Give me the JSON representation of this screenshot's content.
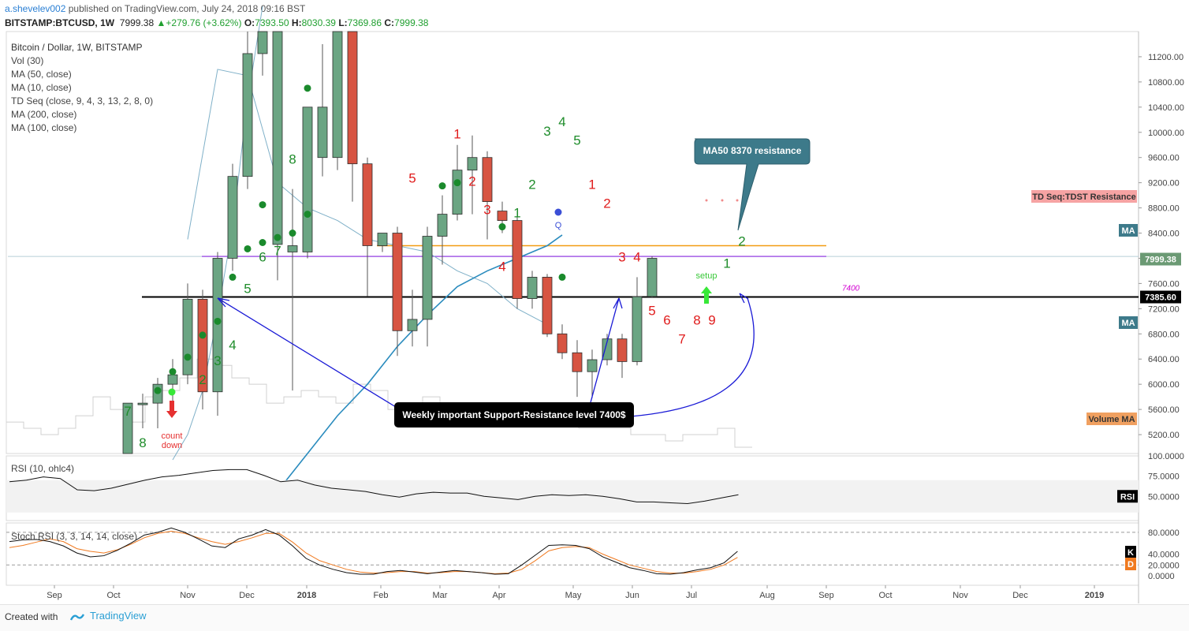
{
  "header": {
    "user": "a.shevelev002",
    "published": "published on TradingView.com, July 24, 2018 09:16 BST",
    "symbol": "BITSTAMP:BTCUSD, 1W",
    "last": "7999.38",
    "change": "+279.76 (+3.62%)",
    "o_label": "O:",
    "o": "7393.50",
    "h_label": "H:",
    "h": "8030.39",
    "l_label": "L:",
    "l": "7369.86",
    "c_label": "C:",
    "c": "7999.38"
  },
  "legend": {
    "title": "Bitcoin / Dollar, 1W, BITSTAMP",
    "items": [
      "Vol (30)",
      "MA (50, close)",
      "MA (10, close)",
      "TD Seq (close, 9, 4, 3, 13, 2, 8, 0)",
      "MA (200, close)",
      "MA (100, close)"
    ]
  },
  "panes": {
    "rsi_label": "RSI (10, ohlc4)",
    "stoch_label": "Stoch RSI (3, 3, 14, 14, close)"
  },
  "footer": {
    "created": "Created with",
    "brand": "TradingView"
  },
  "colors": {
    "up": "#6ba583",
    "down": "#d75442",
    "td_green": "#1e8c2a",
    "td_red": "#e01c1c",
    "ma_blue": "#2b8cbe",
    "ma_thin": "#7fb0c8",
    "orange": "#f39c12",
    "purple": "#8b2be2",
    "callout": "#3d7a8a"
  },
  "chart_data": [
    {
      "type": "candlestick",
      "title": "Bitcoin / Dollar, 1W, BITSTAMP",
      "ylim": [
        4900,
        11600
      ],
      "yticks": [
        5200,
        5600,
        6000,
        6400,
        6800,
        7200,
        7600,
        8000,
        8400,
        8800,
        9200,
        9600,
        10000,
        10400,
        10800,
        11200
      ],
      "ytick_labels": [
        "5200.00",
        "5600.00",
        "6000.00",
        "6400.00",
        "6800.00",
        "7200.00",
        "7600.00",
        "8000.00",
        "8400.00",
        "8800.00",
        "9200.00",
        "9600.00",
        "10000.00",
        "10400.00",
        "10800.00",
        "11200.00"
      ],
      "xlabels": [
        "Sep",
        "Oct",
        "Nov",
        "Dec",
        "2018",
        "Feb",
        "Mar",
        "Apr",
        "May",
        "Jun",
        "Jul",
        "Aug",
        "Sep",
        "Oct",
        "Nov",
        "Dec",
        "2019"
      ],
      "candles": [
        {
          "o": 4600,
          "h": 5500,
          "l": 4200,
          "c": 5700
        },
        {
          "o": 5700,
          "h": 5850,
          "l": 5300,
          "c": 5700
        },
        {
          "o": 5700,
          "h": 6100,
          "l": 5300,
          "c": 6000
        },
        {
          "o": 6000,
          "h": 6400,
          "l": 5500,
          "c": 6150
        },
        {
          "o": 6150,
          "h": 7600,
          "l": 6000,
          "c": 7350
        },
        {
          "o": 7350,
          "h": 7500,
          "l": 5600,
          "c": 5880
        },
        {
          "o": 5880,
          "h": 8100,
          "l": 5500,
          "c": 8000
        },
        {
          "o": 8000,
          "h": 9500,
          "l": 7800,
          "c": 9300
        },
        {
          "o": 9300,
          "h": 11700,
          "l": 9100,
          "c": 11250
        },
        {
          "o": 11250,
          "h": 11800,
          "l": 10900,
          "c": 11700
        },
        {
          "o": 8220,
          "h": 11900,
          "l": 7650,
          "c": 11700
        },
        {
          "o": 8100,
          "h": 9100,
          "l": 5900,
          "c": 8200
        },
        {
          "o": 8100,
          "h": 10400,
          "l": 8000,
          "c": 10400
        },
        {
          "o": 9600,
          "h": 11400,
          "l": 9300,
          "c": 10400
        },
        {
          "o": 9600,
          "h": 11800,
          "l": 9400,
          "c": 11600
        },
        {
          "o": 11600,
          "h": 11700,
          "l": 8900,
          "c": 9500
        },
        {
          "o": 9500,
          "h": 9600,
          "l": 7400,
          "c": 8200
        },
        {
          "o": 8200,
          "h": 8400,
          "l": 8100,
          "c": 8400
        },
        {
          "o": 8400,
          "h": 8500,
          "l": 6450,
          "c": 6850
        },
        {
          "o": 6850,
          "h": 7500,
          "l": 6600,
          "c": 7030
        },
        {
          "o": 7030,
          "h": 8500,
          "l": 6600,
          "c": 8350
        },
        {
          "o": 8350,
          "h": 9000,
          "l": 7900,
          "c": 8700
        },
        {
          "o": 8700,
          "h": 9800,
          "l": 8600,
          "c": 9400
        },
        {
          "o": 9400,
          "h": 9950,
          "l": 8700,
          "c": 9600
        },
        {
          "o": 9600,
          "h": 9700,
          "l": 8300,
          "c": 8900
        },
        {
          "o": 8750,
          "h": 8900,
          "l": 8400,
          "c": 8600
        },
        {
          "o": 8600,
          "h": 8650,
          "l": 7200,
          "c": 7360
        },
        {
          "o": 7360,
          "h": 7800,
          "l": 7200,
          "c": 7700
        },
        {
          "o": 7700,
          "h": 7750,
          "l": 6750,
          "c": 6800
        },
        {
          "o": 6800,
          "h": 6950,
          "l": 6400,
          "c": 6500
        },
        {
          "o": 6500,
          "h": 6700,
          "l": 5800,
          "c": 6200
        },
        {
          "o": 6200,
          "h": 6550,
          "l": 5780,
          "c": 6390
        },
        {
          "o": 6390,
          "h": 6800,
          "l": 6300,
          "c": 6720
        },
        {
          "o": 6720,
          "h": 6800,
          "l": 6100,
          "c": 6360
        },
        {
          "o": 6360,
          "h": 7700,
          "l": 6300,
          "c": 7390
        },
        {
          "o": 7393.5,
          "h": 8030.39,
          "l": 7369.86,
          "c": 7999.38
        }
      ],
      "ma50": [
        [
          17,
          4300
        ],
        [
          19,
          4900
        ],
        [
          21,
          5500
        ],
        [
          23,
          6000
        ],
        [
          25,
          6600
        ],
        [
          27,
          7100
        ],
        [
          29,
          7550
        ],
        [
          31,
          7800
        ],
        [
          33,
          8000
        ],
        [
          35,
          8200
        ],
        [
          36,
          8370
        ]
      ],
      "ma10": [
        [
          11,
          8300
        ],
        [
          13,
          11000
        ],
        [
          15,
          10900
        ],
        [
          17,
          9200
        ],
        [
          19,
          8800
        ],
        [
          21,
          8600
        ],
        [
          23,
          8300
        ],
        [
          25,
          8200
        ],
        [
          27,
          8100
        ],
        [
          29,
          7800
        ],
        [
          31,
          7600
        ],
        [
          33,
          7200
        ],
        [
          35,
          6950
        ]
      ],
      "ma_rise": [
        [
          10,
          4800
        ],
        [
          11,
          5200
        ],
        [
          12,
          5900
        ],
        [
          13,
          7100
        ],
        [
          14,
          8500
        ],
        [
          15,
          10500
        ],
        [
          16,
          12000
        ]
      ],
      "td_labels": [
        {
          "i": 0,
          "t": "7",
          "c": "g",
          "y": 5500
        },
        {
          "i": 1,
          "t": "8",
          "c": "g",
          "y": 5000
        },
        {
          "i": 5,
          "t": "2",
          "c": "g",
          "y": 6000
        },
        {
          "i": 6,
          "t": "3",
          "c": "g",
          "y": 6300
        },
        {
          "i": 7,
          "t": "4",
          "c": "g",
          "y": 6550
        },
        {
          "i": 8,
          "t": "5",
          "c": "g",
          "y": 7450
        },
        {
          "i": 9,
          "t": "6",
          "c": "g",
          "y": 7950
        },
        {
          "i": 10,
          "t": "7",
          "c": "g",
          "y": 8050
        },
        {
          "i": 11,
          "t": "8",
          "c": "g",
          "y": 9500
        },
        {
          "i": 19,
          "t": "5",
          "c": "r",
          "y": 9200
        },
        {
          "i": 22,
          "t": "1",
          "c": "r",
          "y": 9900
        },
        {
          "i": 23,
          "t": "2",
          "c": "r",
          "y": 9150
        },
        {
          "i": 24,
          "t": "3",
          "c": "r",
          "y": 8700
        },
        {
          "i": 25,
          "t": "4",
          "c": "r",
          "y": 7800
        },
        {
          "i": 26,
          "t": "1",
          "c": "g",
          "y": 8650
        },
        {
          "i": 27,
          "t": "2",
          "c": "g",
          "y": 9100
        },
        {
          "i": 28,
          "t": "3",
          "c": "g",
          "y": 9950
        },
        {
          "i": 29,
          "t": "4",
          "c": "g",
          "y": 10100
        },
        {
          "i": 30,
          "t": "5",
          "c": "g",
          "y": 9800
        },
        {
          "i": 31,
          "t": "1",
          "c": "r",
          "y": 9100
        },
        {
          "i": 32,
          "t": "2",
          "c": "r",
          "y": 8800
        },
        {
          "i": 33,
          "t": "3",
          "c": "r",
          "y": 7950
        },
        {
          "i": 34,
          "t": "4",
          "c": "r",
          "y": 7950
        },
        {
          "i": 35,
          "t": "5",
          "c": "r",
          "y": 7100
        },
        {
          "i": 36,
          "t": "6",
          "c": "r",
          "y": 6950
        },
        {
          "i": 37,
          "t": "7",
          "c": "r",
          "y": 6650
        },
        {
          "i": 38,
          "t": "8",
          "c": "r",
          "y": 6950
        },
        {
          "i": 39,
          "t": "9",
          "c": "r",
          "y": 6950
        },
        {
          "i": 40,
          "t": "1",
          "c": "g",
          "y": 7850
        },
        {
          "i": 41,
          "t": "2",
          "c": "g",
          "y": 8200
        }
      ],
      "annotations": {
        "support_value": 7385.6,
        "support_label": "7385.60",
        "support_note": "7400",
        "support_text": "Weekly important Support-Resistance level 7400$",
        "ma50_callout": "MA50 8370 resistance",
        "tdst_label": "TD Seq:TDST Resistance",
        "last_price": "7999.38",
        "ma_tag": "MA",
        "volume_ma_tag": "Volume MA",
        "setup": "setup",
        "countdown": "count\ndown",
        "q_marker": "Q"
      }
    },
    {
      "type": "line",
      "title": "RSI (10, ohlc4)",
      "ylim": [
        20,
        100
      ],
      "yticks": [
        50,
        75,
        100
      ],
      "ytick_labels": [
        "50.0000",
        "75.0000",
        "100.0000"
      ],
      "values": [
        68,
        70,
        74,
        72,
        58,
        57,
        60,
        65,
        70,
        74,
        76,
        79,
        82,
        83,
        83,
        76,
        68,
        70,
        64,
        60,
        58,
        56,
        52,
        49,
        53,
        55,
        54,
        54,
        50,
        48,
        46,
        50,
        52,
        51,
        52,
        50,
        47,
        43,
        43,
        42,
        41,
        44,
        48,
        52
      ],
      "last_label": "RSI"
    },
    {
      "type": "line",
      "title": "Stoch RSI (3, 3, 14, 14, close)",
      "ylim": [
        -10,
        90
      ],
      "yticks": [
        0,
        20,
        40,
        80
      ],
      "ytick_labels": [
        "0.0000",
        "20.0000",
        "40.0000",
        "80.0000"
      ],
      "series": [
        {
          "name": "K",
          "values": [
            63,
            66,
            67,
            63,
            55,
            42,
            35,
            37,
            47,
            60,
            75,
            80,
            88,
            80,
            68,
            55,
            52,
            68,
            75,
            85,
            75,
            55,
            32,
            20,
            12,
            6,
            3,
            3,
            8,
            10,
            7,
            4,
            7,
            10,
            8,
            6,
            3,
            4,
            20,
            38,
            56,
            57,
            56,
            50,
            35,
            25,
            15,
            10,
            4,
            3,
            6,
            11,
            15,
            24,
            45
          ]
        },
        {
          "name": "D",
          "values": [
            52,
            56,
            62,
            68,
            63,
            50,
            45,
            42,
            48,
            58,
            70,
            78,
            82,
            78,
            70,
            63,
            58,
            63,
            70,
            78,
            78,
            62,
            42,
            28,
            20,
            12,
            7,
            5,
            6,
            8,
            8,
            5,
            6,
            8,
            8,
            6,
            4,
            5,
            12,
            28,
            46,
            52,
            54,
            52,
            40,
            30,
            20,
            14,
            8,
            5,
            5,
            8,
            12,
            20,
            34
          ]
        }
      ],
      "last_labels": [
        "K",
        "D"
      ]
    }
  ]
}
